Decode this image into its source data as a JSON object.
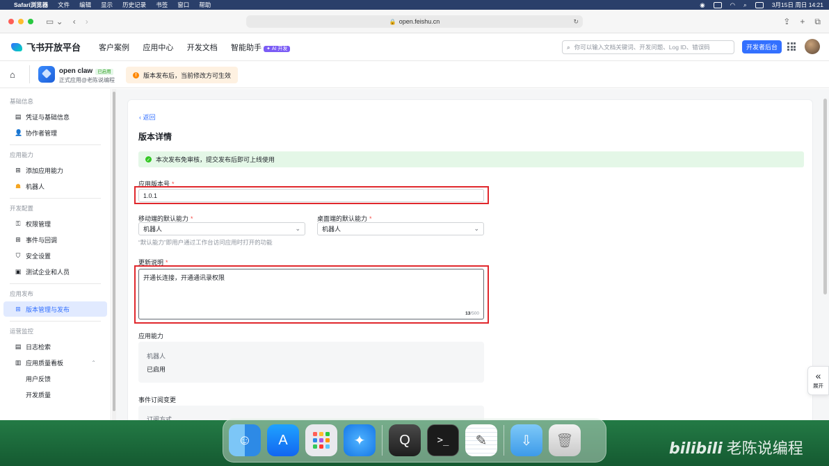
{
  "menubar": {
    "app_name": "Safari浏览器",
    "items": [
      "文件",
      "编辑",
      "显示",
      "历史记录",
      "书签",
      "窗口",
      "帮助"
    ],
    "datetime": "3月15日 周日  14:21"
  },
  "browser": {
    "url": "open.feishu.cn"
  },
  "site": {
    "logo_text": "飞书开放平台",
    "nav": [
      "客户案例",
      "应用中心",
      "开发文档",
      "智能助手"
    ],
    "ai_badge": "✦ AI 开发",
    "search_placeholder": "你可以输入文档关键词、开发问题、Log ID、错误码",
    "dev_console": "开发者后台"
  },
  "app": {
    "name": "open claw",
    "status_badge": "已启用",
    "subtitle": "正式应用@老陈说编程",
    "notice": "版本发布后，当前修改方可生效"
  },
  "sidebar": {
    "sections": [
      {
        "title": "基础信息",
        "items": [
          "凭证与基础信息",
          "协作者管理"
        ]
      },
      {
        "title": "应用能力",
        "items": [
          "添加应用能力",
          "机器人"
        ]
      },
      {
        "title": "开发配置",
        "items": [
          "权限管理",
          "事件与回调",
          "安全设置",
          "测试企业和人员"
        ]
      },
      {
        "title": "应用发布",
        "items": [
          "版本管理与发布"
        ]
      },
      {
        "title": "运营监控",
        "items": [
          "日志检索",
          "应用质量看板"
        ],
        "subitems": [
          "用户反馈",
          "开发质量"
        ]
      }
    ]
  },
  "main": {
    "back": "返回",
    "title": "版本详情",
    "success_banner": "本次发布免审核，提交发布后即可上线使用",
    "version_label": "应用版本号",
    "version_value": "1.0.1",
    "mobile_label": "移动端的默认能力",
    "mobile_value": "机器人",
    "desktop_label": "桌面端的默认能力",
    "desktop_value": "机器人",
    "default_hint": "“默认能力”即用户通过工作台访问应用时打开的功能",
    "notes_label": "更新说明",
    "notes_value": "开通长连接，开通通讯录权限",
    "notes_count": "13",
    "notes_max": "/500",
    "capability_label": "应用能力",
    "capability_name": "机器人",
    "capability_status": "已启用",
    "event_label": "事件订阅变更",
    "event_sub": "订阅方式"
  },
  "expand": {
    "icon": "«",
    "label": "展开"
  },
  "watermark": {
    "brand": "bilibili",
    "text": "老陈说编程"
  }
}
